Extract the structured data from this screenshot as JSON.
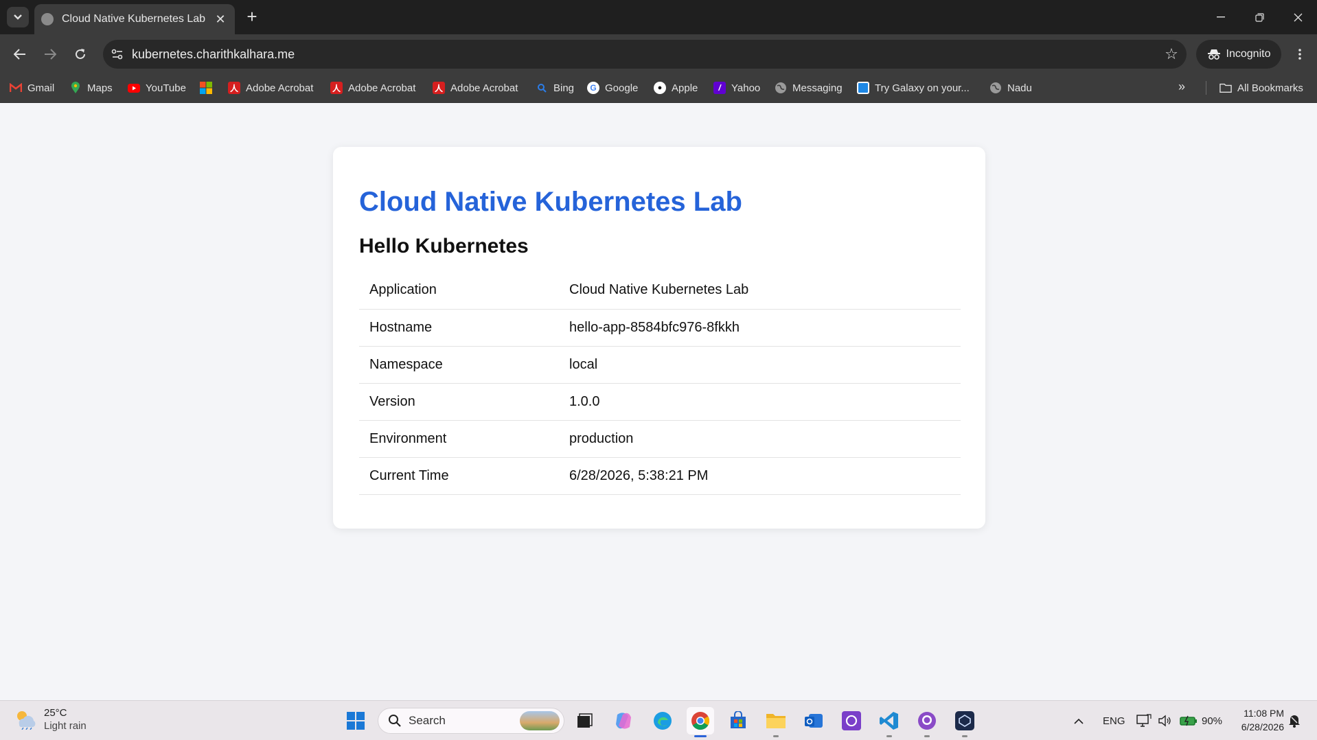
{
  "browser": {
    "tab_title": "Cloud Native Kubernetes Lab",
    "url": "kubernetes.charithkalhara.me",
    "incognito_label": "Incognito",
    "bookmarks": [
      {
        "label": "Gmail",
        "icon": "gmail-icon",
        "color": "#ea4335"
      },
      {
        "label": "Maps",
        "icon": "maps-icon",
        "color": "#34a853"
      },
      {
        "label": "YouTube",
        "icon": "youtube-icon",
        "color": "#ff0000"
      },
      {
        "label": "",
        "icon": "microsoft-icon",
        "color": "#f25022"
      },
      {
        "label": "Adobe Acrobat",
        "icon": "acrobat-icon",
        "color": "#d61f1f"
      },
      {
        "label": "Adobe Acrobat",
        "icon": "acrobat-icon",
        "color": "#d61f1f"
      },
      {
        "label": "Adobe Acrobat",
        "icon": "acrobat-icon",
        "color": "#d61f1f"
      },
      {
        "label": "Bing",
        "icon": "bing-icon",
        "color": "#2b7de9"
      },
      {
        "label": "Google",
        "icon": "google-icon",
        "color": "#4285f4"
      },
      {
        "label": "Apple",
        "icon": "apple-icon",
        "color": "#ffffff"
      },
      {
        "label": "Yahoo",
        "icon": "yahoo-icon",
        "color": "#6001d2"
      },
      {
        "label": "Messaging",
        "icon": "globe-icon",
        "color": "#9a9a9a"
      },
      {
        "label": "Try Galaxy on your...",
        "icon": "galaxy-icon",
        "color": "#1e88e5"
      },
      {
        "label": "Nadu",
        "icon": "globe-icon",
        "color": "#9a9a9a"
      }
    ],
    "all_bookmarks_label": "All Bookmarks"
  },
  "page": {
    "title": "Cloud Native Kubernetes Lab",
    "greeting": "Hello Kubernetes",
    "rows": [
      {
        "key": "Application",
        "value": "Cloud Native Kubernetes Lab"
      },
      {
        "key": "Hostname",
        "value": "hello-app-8584bfc976-8fkkh"
      },
      {
        "key": "Namespace",
        "value": "local"
      },
      {
        "key": "Version",
        "value": "1.0.0"
      },
      {
        "key": "Environment",
        "value": "production"
      },
      {
        "key": "Current Time",
        "value": "6/28/2026, 5:38:21 PM"
      }
    ],
    "accent_color": "#2563d9"
  },
  "taskbar": {
    "weather": {
      "temp": "25°C",
      "condition": "Light rain"
    },
    "search_label": "Search",
    "apps": [
      {
        "name": "start-button",
        "color": "#1a78d6"
      },
      {
        "name": "task-view",
        "color": "#222222"
      },
      {
        "name": "copilot",
        "color": "#c46ad6"
      },
      {
        "name": "edge",
        "color": "#1b9de2"
      },
      {
        "name": "chrome",
        "color": "#db4437"
      },
      {
        "name": "store",
        "color": "#2466c9"
      },
      {
        "name": "file-explorer",
        "color": "#f0b429"
      },
      {
        "name": "outlook",
        "color": "#2775d8"
      },
      {
        "name": "app-purple",
        "color": "#7a3fc9"
      },
      {
        "name": "vscode",
        "color": "#1f8ad2"
      },
      {
        "name": "github-desktop",
        "color": "#8a4bc7"
      },
      {
        "name": "app-dark",
        "color": "#1c2a4a"
      }
    ],
    "language": "ENG",
    "battery": "90%",
    "time": "11:08 PM",
    "date": "6/28/2026"
  }
}
